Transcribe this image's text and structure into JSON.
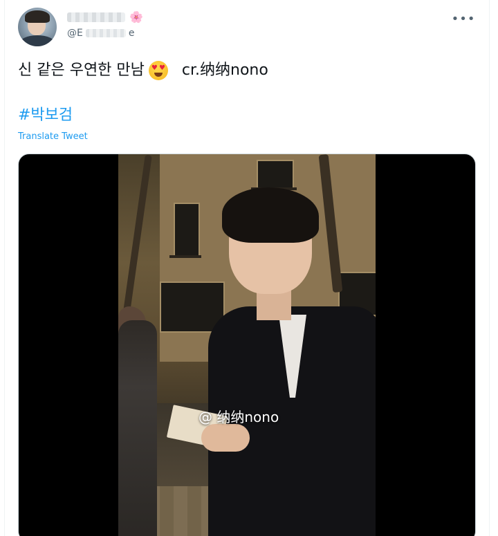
{
  "header": {
    "handle_prefix": "@E",
    "handle_suffix": "e",
    "flower_icon": "🌸"
  },
  "tweet": {
    "text": "신 같은 우연한 만남",
    "emoji": "heart-eyes-emoji",
    "credit": "cr.纳纳nono",
    "hashtag": "#박보검",
    "translate_label": "Translate Tweet"
  },
  "media": {
    "watermark": "@ 纳纳nono"
  },
  "colors": {
    "link": "#1d9bf0",
    "secondary_text": "#536471",
    "text": "#0f1419"
  }
}
